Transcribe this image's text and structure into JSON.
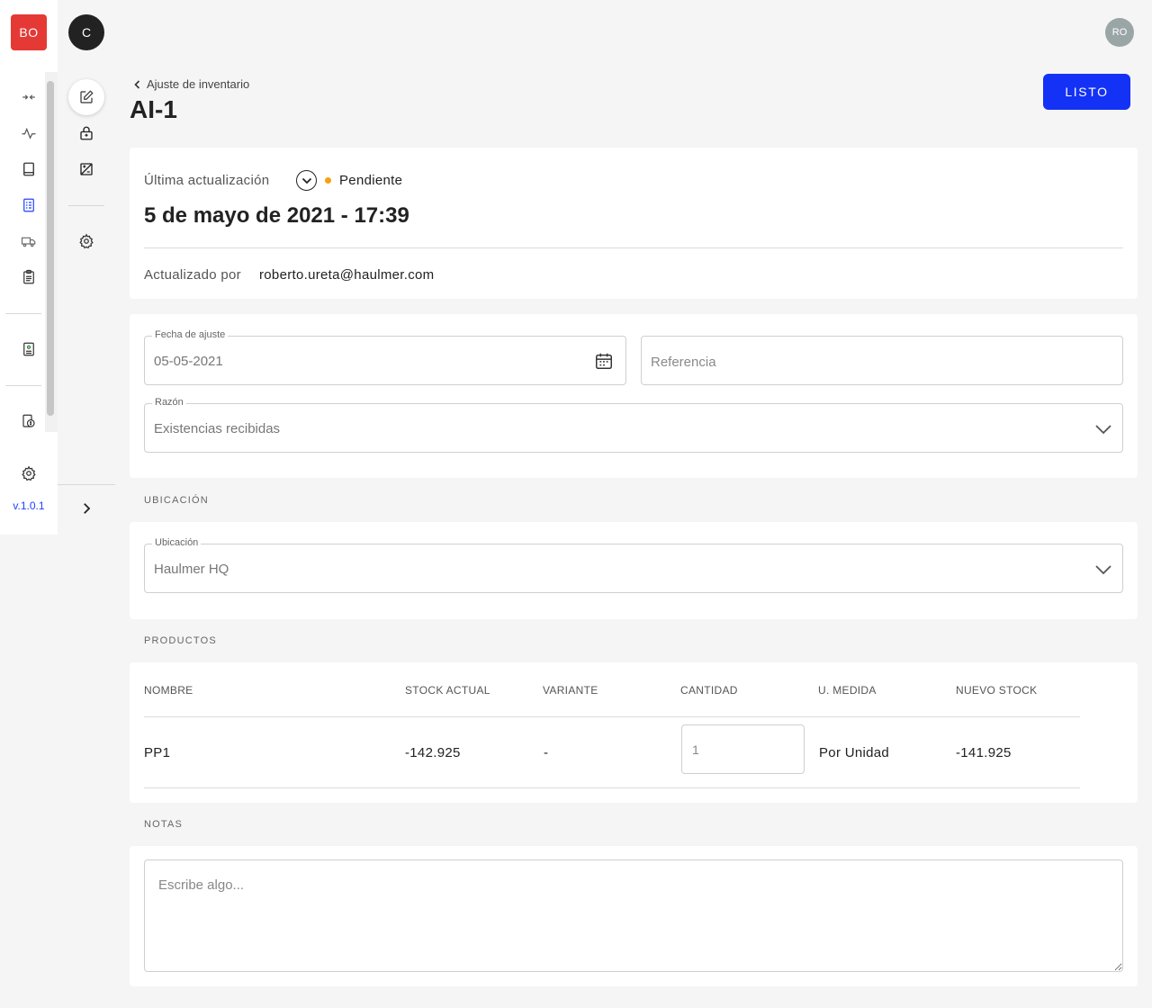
{
  "rail": {
    "logo": "BO",
    "version": "v.1.0.1",
    "icons": [
      "transfer-icon",
      "activity-icon",
      "book-icon",
      "checklist-icon",
      "truck-icon",
      "clipboard-icon",
      "document-user-icon",
      "money-document-icon",
      "gear-icon"
    ],
    "accent": "#1e40ff"
  },
  "rail2": {
    "avatar": "C",
    "icons": [
      "edit-icon",
      "lock-box-icon",
      "adjust-image-icon",
      "gear-icon",
      "chevron-right-icon"
    ]
  },
  "header": {
    "user_initials": "RO",
    "breadcrumb": "Ajuste de inventario",
    "title": "AI-1",
    "done_label": "LISTO",
    "done_color": "#1432f5"
  },
  "status": {
    "last_update_label": "Última actualización",
    "state": "Pendiente",
    "state_color": "#f6a10b",
    "date": "5 de mayo de 2021 - 17:39",
    "updated_by_label": "Actualizado por",
    "updated_by": "roberto.ureta@haulmer.com"
  },
  "form": {
    "date_label": "Fecha de ajuste",
    "date_value": "05-05-2021",
    "reference_placeholder": "Referencia",
    "reason_label": "Razón",
    "reason_value": "Existencias recibidas"
  },
  "location": {
    "section": "UBICACIÓN",
    "label": "Ubicación",
    "value": "Haulmer HQ"
  },
  "products": {
    "section": "PRODUCTOS",
    "columns": [
      "NOMBRE",
      "STOCK ACTUAL",
      "VARIANTE",
      "CANTIDAD",
      "U. MEDIDA",
      "NUEVO STOCK"
    ],
    "rows": [
      {
        "name": "PP1",
        "stock": "-142.925",
        "variant": "-",
        "quantity": "1",
        "unit": "Por Unidad",
        "new_stock": "-141.925"
      }
    ]
  },
  "notes": {
    "section": "NOTAS",
    "placeholder": "Escribe algo..."
  }
}
